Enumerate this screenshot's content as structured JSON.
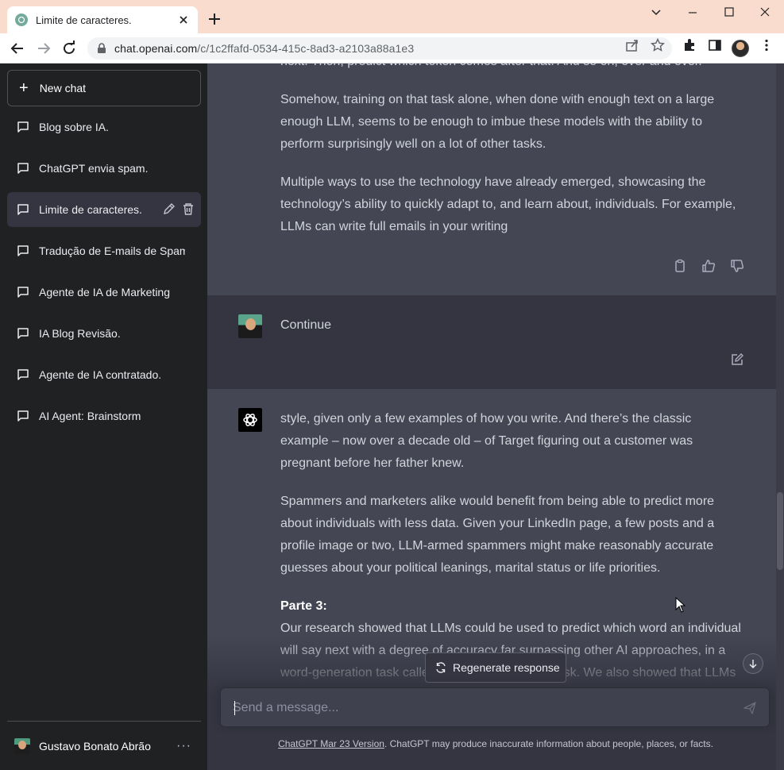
{
  "browser": {
    "tab_title": "Limite de caracteres.",
    "url_host": "chat.openai.com",
    "url_path": "/c/1c2ffafd-0534-415c-8ad3-a2103a88a1e3"
  },
  "sidebar": {
    "new_chat": "New chat",
    "items": [
      {
        "label": "Blog sobre IA."
      },
      {
        "label": "ChatGPT envia spam."
      },
      {
        "label": "Limite de caracteres."
      },
      {
        "label": "Tradução de E-mails de Spam"
      },
      {
        "label": "Agente de IA de Marketing"
      },
      {
        "label": "IA Blog Revisão."
      },
      {
        "label": "Agente de IA contratado."
      },
      {
        "label": "AI Agent: Brainstorm"
      }
    ],
    "user_name": "Gustavo Bonato Abrão",
    "more": "···"
  },
  "conversation": {
    "prev_bot": {
      "p0": "next. Then, predict which token comes after that. And so on, over and over.",
      "p1": "Somehow, training on that task alone, when done with enough text on a large enough LLM, seems to be enough to imbue these models with the ability to perform surprisingly well on a lot of other tasks.",
      "p2": "Multiple ways to use the technology have already emerged, showcasing the technology’s ability to quickly adapt to, and learn about, individuals. For example, LLMs can write full emails in your writing"
    },
    "user_msg": "Continue",
    "bot": {
      "p1": "style, given only a few examples of how you write. And there’s the classic example – now over a decade old – of Target figuring out a customer was pregnant before her father knew.",
      "p2": "Spammers and marketers alike would benefit from being able to predict more about individuals with less data. Given your LinkedIn page, a few posts and a profile image or two, LLM-armed spammers might make reasonably accurate guesses about your political leanings, marital status or life priorities.",
      "heading": "Parte 3:",
      "p3": "Our research showed that LLMs could be used to predict which word an individual will say next with a degree of accuracy far surpassing other AI approaches, in a word-generation task called the Shannon Game task. We also showed that LLMs"
    }
  },
  "composer": {
    "regenerate": "Regenerate response",
    "placeholder": "Send a message..."
  },
  "footer": {
    "version_link": "ChatGPT Mar 23 Version",
    "disclaimer": ". ChatGPT may produce inaccurate information about people, places, or facts."
  }
}
